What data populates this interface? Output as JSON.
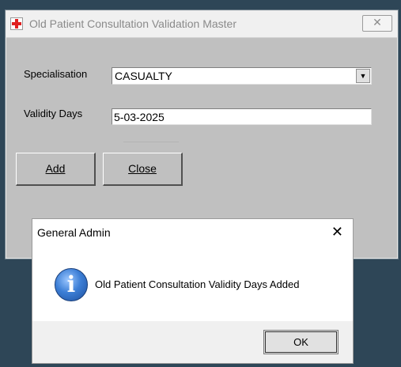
{
  "main_window": {
    "title": "Old Patient Consultation Validation Master",
    "close_glyph": "✕",
    "icon": "app-red-cross-icon",
    "form": {
      "specialisation_label": "Specialisation",
      "specialisation_value": "CASUALTY",
      "dropdown_arrow": "▼",
      "validity_days_label": "Validity Days",
      "validity_days_value": "5-03-2025"
    },
    "buttons": {
      "add_label": "Add",
      "close_label": "Close"
    }
  },
  "dialog": {
    "title": "General Admin",
    "close_glyph": "✕",
    "icon": "info-icon",
    "info_glyph": "i",
    "message": "Old Patient Consultation Validity Days Added",
    "ok_label": "OK"
  }
}
